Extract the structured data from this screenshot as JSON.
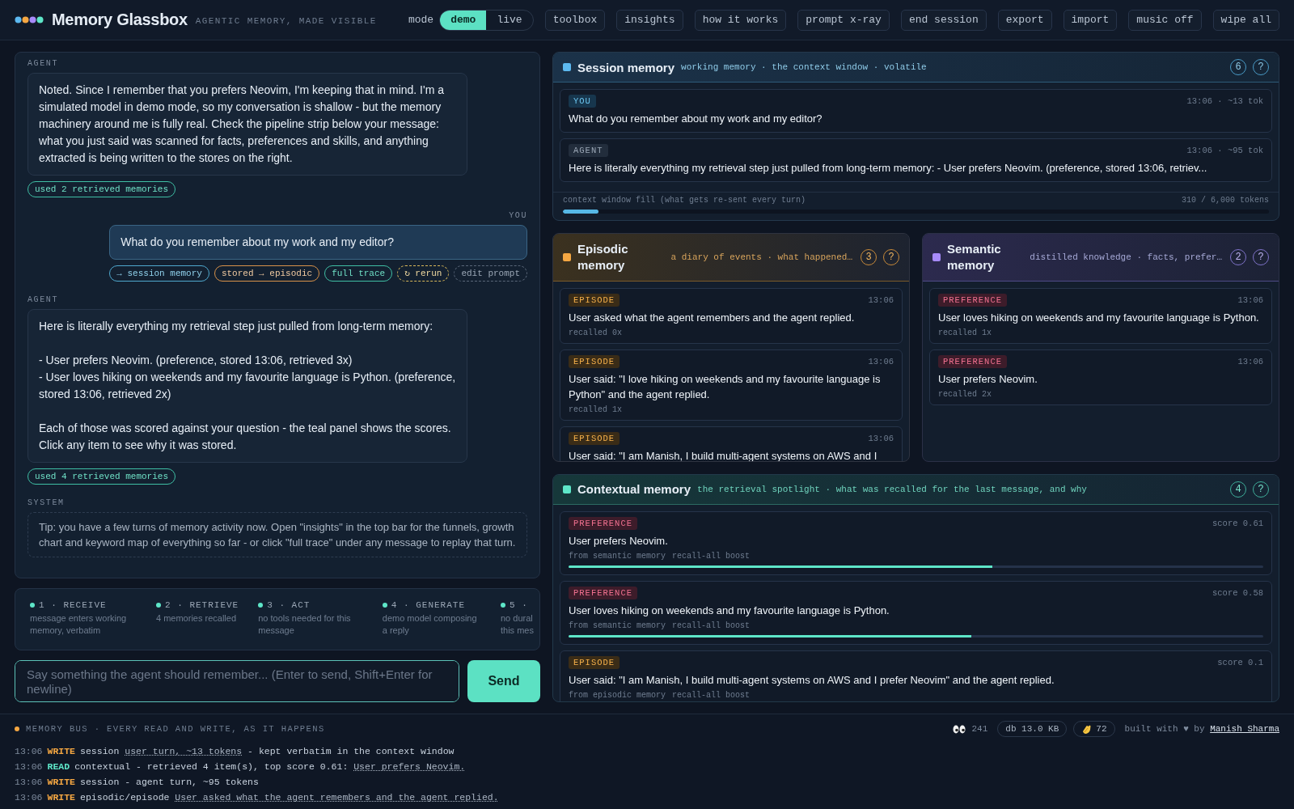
{
  "header": {
    "title": "Memory Glassbox",
    "tagline": "AGENTIC MEMORY, MADE VISIBLE",
    "mode_label": "mode",
    "modes": [
      {
        "label": "demo",
        "selected": true
      },
      {
        "label": "live",
        "selected": false
      }
    ],
    "buttons": [
      "toolbox",
      "insights",
      "how it works",
      "prompt x-ray",
      "end session",
      "export",
      "import",
      "music off",
      "wipe all"
    ]
  },
  "chat": {
    "messages": [
      {
        "kind": "agent",
        "role": "AGENT",
        "text": "Noted. Since I remember that you prefers Neovim, I'm keeping that in mind. I'm a simulated model in demo mode, so my conversation is shallow - but the memory machinery around me is fully real. Check the pipeline strip below your message: what you just said was scanned for facts, preferences and skills, and anything extracted is being written to the stores on the right.",
        "chips": [
          {
            "kind": "retrieved",
            "label": "used 2 retrieved memories"
          }
        ]
      },
      {
        "kind": "user",
        "role": "YOU",
        "text": "What do you remember about my work and my editor?",
        "chips": [
          {
            "kind": "session",
            "label": "→ session memory"
          },
          {
            "kind": "stored",
            "label": "stored → episodic"
          },
          {
            "kind": "trace",
            "label": "full trace"
          },
          {
            "kind": "rerun",
            "label": "↻ rerun"
          },
          {
            "kind": "edit",
            "label": "edit prompt"
          }
        ]
      },
      {
        "kind": "agent",
        "role": "AGENT",
        "text": "Here is literally everything my retrieval step just pulled from long-term memory:\n\n- User prefers Neovim. (preference, stored 13:06, retrieved 3x)\n- User loves hiking on weekends and my favourite language is Python. (preference, stored 13:06, retrieved 2x)\n\nEach of those was scored against your question - the teal panel shows the scores. Click any item to see why it was stored.",
        "chips": [
          {
            "kind": "retrieved",
            "label": "used 4 retrieved memories"
          }
        ]
      },
      {
        "kind": "system",
        "role": "SYSTEM",
        "text": "Tip: you have a few turns of memory activity now. Open \"insights\" in the top bar for the funnels, growth chart and keyword map of everything so far - or click \"full trace\" under any message to replay that turn."
      }
    ]
  },
  "pipeline": [
    {
      "label": "1 · RECEIVE",
      "detail": "message enters working memory, verbatim"
    },
    {
      "label": "2 · RETRIEVE",
      "detail": "4 memories recalled"
    },
    {
      "label": "3 · ACT",
      "detail": "no tools needed for this message"
    },
    {
      "label": "4 · GENERATE",
      "detail": "demo model composing a reply"
    },
    {
      "label": "5 ·",
      "detail": "no dural this mes"
    }
  ],
  "composer": {
    "placeholder": "Say something the agent should remember... (Enter to send, Shift+Enter for newline)",
    "send": "Send"
  },
  "session_memory": {
    "title": "Session memory",
    "subtitle": "working memory · the context window · volatile",
    "count": "6",
    "help": "?",
    "items": [
      {
        "kind": "you",
        "tag": "YOU",
        "meta": "13:06 · ~13 tok",
        "text": "What do you remember about my work and my editor?"
      },
      {
        "kind": "agent",
        "tag": "AGENT",
        "meta": "13:06 · ~95 tok",
        "text": "Here is literally everything my retrieval step just pulled from long-term memory: - User prefers Neovim. (preference, stored 13:06, retriev..."
      }
    ],
    "fill_label": "context window fill (what gets re-sent every turn)",
    "fill_reading": "310 / 6,000 tokens",
    "level": 0.05
  },
  "episodic_memory": {
    "title": "Episodic memory",
    "subtitle": "a diary of events · what happened…",
    "count": "3",
    "help": "?",
    "items": [
      {
        "kind": "episode",
        "tag": "EPISODE",
        "time": "13:06",
        "text": "User asked what the agent remembers and the agent replied.",
        "recalled": "recalled 0x"
      },
      {
        "kind": "episode",
        "tag": "EPISODE",
        "time": "13:06",
        "text": "User said: \"I love hiking on weekends and my favourite language is Python\" and the agent replied.",
        "recalled": "recalled 1x"
      },
      {
        "kind": "episode",
        "tag": "EPISODE",
        "time": "13:06",
        "text": "User said: \"I am Manish, I build multi-agent systems on AWS and I"
      }
    ]
  },
  "semantic_memory": {
    "title": "Semantic memory",
    "subtitle": "distilled knowledge · facts, prefer…",
    "count": "2",
    "help": "?",
    "items": [
      {
        "kind": "preference",
        "tag": "PREFERENCE",
        "time": "13:06",
        "text": "User loves hiking on weekends and my favourite language is Python.",
        "recalled": "recalled 1x"
      },
      {
        "kind": "preference",
        "tag": "PREFERENCE",
        "time": "13:06",
        "text": "User prefers Neovim.",
        "recalled": "recalled 2x"
      }
    ]
  },
  "contextual_memory": {
    "title": "Contextual memory",
    "subtitle": "the retrieval spotlight · what was recalled for the last message, and why",
    "count": "4",
    "help": "?",
    "items": [
      {
        "kind": "preference",
        "tag": "PREFERENCE",
        "score": "score 0.61",
        "text": "User prefers Neovim.",
        "sources": [
          "from semantic memory",
          "recall-all boost"
        ],
        "level": 0.61
      },
      {
        "kind": "preference",
        "tag": "PREFERENCE",
        "score": "score 0.58",
        "text": "User loves hiking on weekends and my favourite language is Python.",
        "sources": [
          "from semantic memory",
          "recall-all boost"
        ],
        "level": 0.58
      },
      {
        "kind": "episode",
        "tag": "EPISODE",
        "score": "score 0.1",
        "text": "User said: \"I am Manish, I build multi-agent systems on AWS and I prefer Neovim\" and the agent replied.",
        "sources": [
          "from episodic memory",
          "recall-all boost"
        ]
      }
    ]
  },
  "memory_bus": {
    "title": "MEMORY BUS · EVERY READ AND WRITE, AS IT HAPPENS",
    "views": "241",
    "db": "db 13.0 KB",
    "claps": "72",
    "credit": "built with ♥ by",
    "author": "Manish Sharma",
    "events": [
      {
        "time": "13:06",
        "op": "WRITE",
        "kind": "write",
        "text": "session",
        "link": "user turn, ~13 tokens",
        "after": "- kept verbatim in the context window"
      },
      {
        "time": "13:06",
        "op": "READ",
        "kind": "read",
        "text": "contextual - retrieved 4 item(s), top score 0.61:",
        "link": "User prefers Neovim."
      },
      {
        "time": "13:06",
        "op": "WRITE",
        "kind": "write",
        "text": "session - agent turn, ~95 tokens"
      },
      {
        "time": "13:06",
        "op": "WRITE",
        "kind": "write",
        "text": "episodic/episode",
        "link": "User asked what the agent remembers and the agent replied."
      }
    ]
  }
}
